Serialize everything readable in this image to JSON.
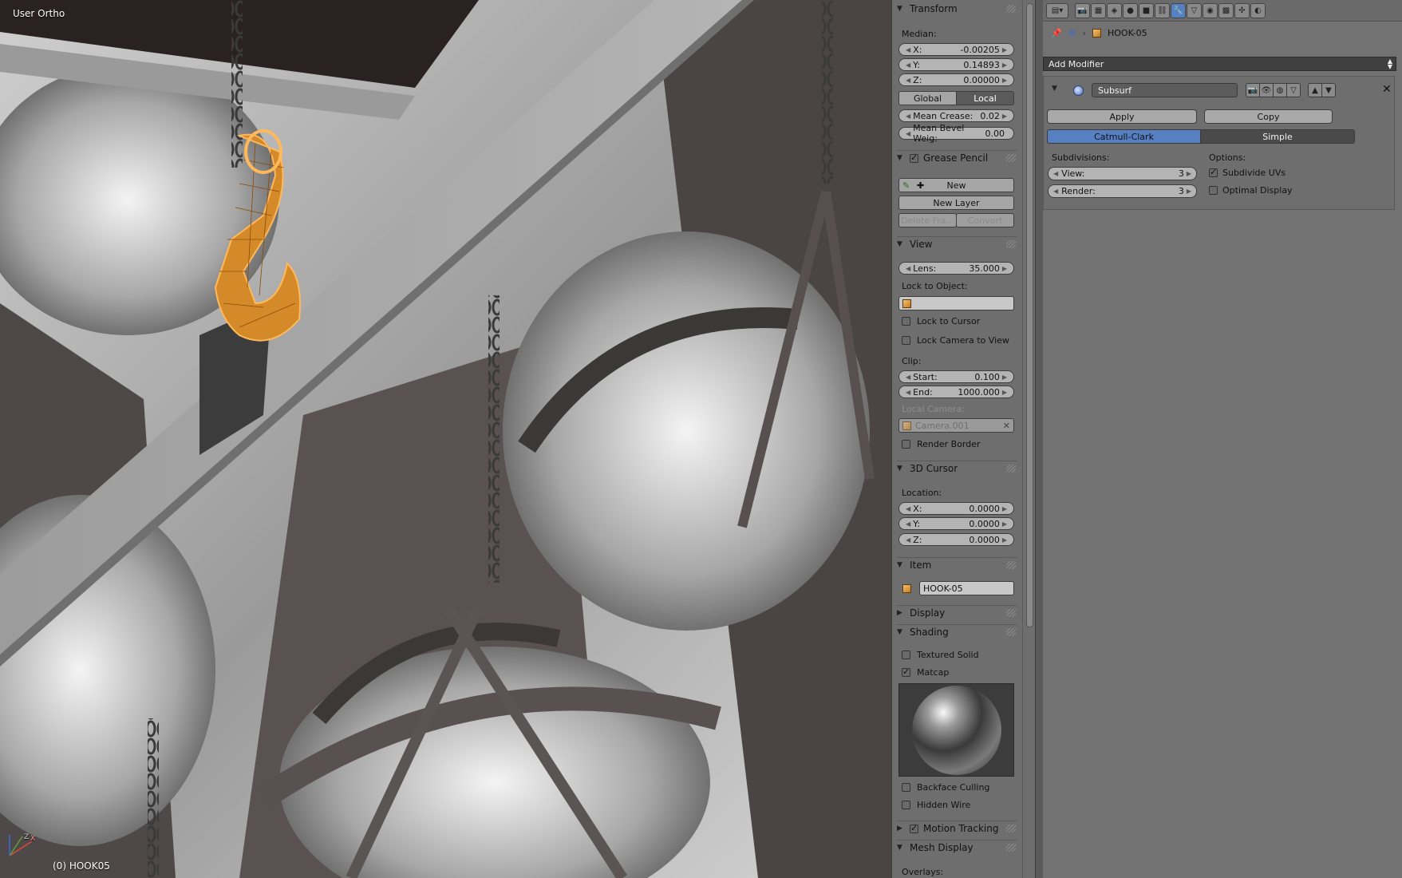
{
  "viewport": {
    "view_label": "User Ortho",
    "object_label": "(0) HOOK05",
    "axis_labels": {
      "x": "X",
      "y": "Y",
      "z": "Z"
    }
  },
  "transform": {
    "title": "Transform",
    "median_label": "Median:",
    "x": {
      "key": "X:",
      "value": "-0.00205"
    },
    "y": {
      "key": "Y:",
      "value": "0.14893"
    },
    "z": {
      "key": "Z:",
      "value": "0.00000"
    },
    "global_label": "Global",
    "local_label": "Local",
    "mean_crease": {
      "key": "Mean Crease:",
      "value": "0.02"
    },
    "mean_bevel": {
      "key": "Mean Bevel Weig:",
      "value": "0.00"
    }
  },
  "grease_pencil": {
    "title": "Grease Pencil",
    "new_label": "New",
    "new_layer_label": "New Layer",
    "delete_frame_label": "Delete Fra...",
    "convert_label": "Convert"
  },
  "view": {
    "title": "View",
    "lens": {
      "key": "Lens:",
      "value": "35.000"
    },
    "lock_to_object_label": "Lock to Object:",
    "lock_to_cursor_label": "Lock to Cursor",
    "lock_camera_label": "Lock Camera to View",
    "clip_label": "Clip:",
    "start": {
      "key": "Start:",
      "value": "0.100"
    },
    "end": {
      "key": "End:",
      "value": "1000.000"
    },
    "local_camera_label": "Local Camera:",
    "local_camera_value": "Camera.001",
    "render_border_label": "Render Border"
  },
  "cursor": {
    "title": "3D Cursor",
    "location_label": "Location:",
    "x": {
      "key": "X:",
      "value": "0.0000"
    },
    "y": {
      "key": "Y:",
      "value": "0.0000"
    },
    "z": {
      "key": "Z:",
      "value": "0.0000"
    }
  },
  "item": {
    "title": "Item",
    "name": "HOOK-05"
  },
  "display": {
    "title": "Display"
  },
  "shading": {
    "title": "Shading",
    "textured_solid_label": "Textured Solid",
    "matcap_label": "Matcap",
    "backface_label": "Backface Culling",
    "hidden_wire_label": "Hidden Wire"
  },
  "motion_tracking": {
    "title": "Motion Tracking"
  },
  "mesh_display": {
    "title": "Mesh Display",
    "overlays_label": "Overlays:"
  },
  "properties": {
    "object_name": "HOOK-05",
    "add_modifier_label": "Add Modifier",
    "modifier_name": "Subsurf",
    "apply_label": "Apply",
    "copy_label": "Copy",
    "catmull_label": "Catmull-Clark",
    "simple_label": "Simple",
    "subdivisions_label": "Subdivisions:",
    "options_label": "Options:",
    "view_subdiv": {
      "key": "View:",
      "value": "3"
    },
    "render_subdiv": {
      "key": "Render:",
      "value": "3"
    },
    "subdivide_uvs_label": "Subdivide UVs",
    "optimal_display_label": "Optimal Display"
  }
}
